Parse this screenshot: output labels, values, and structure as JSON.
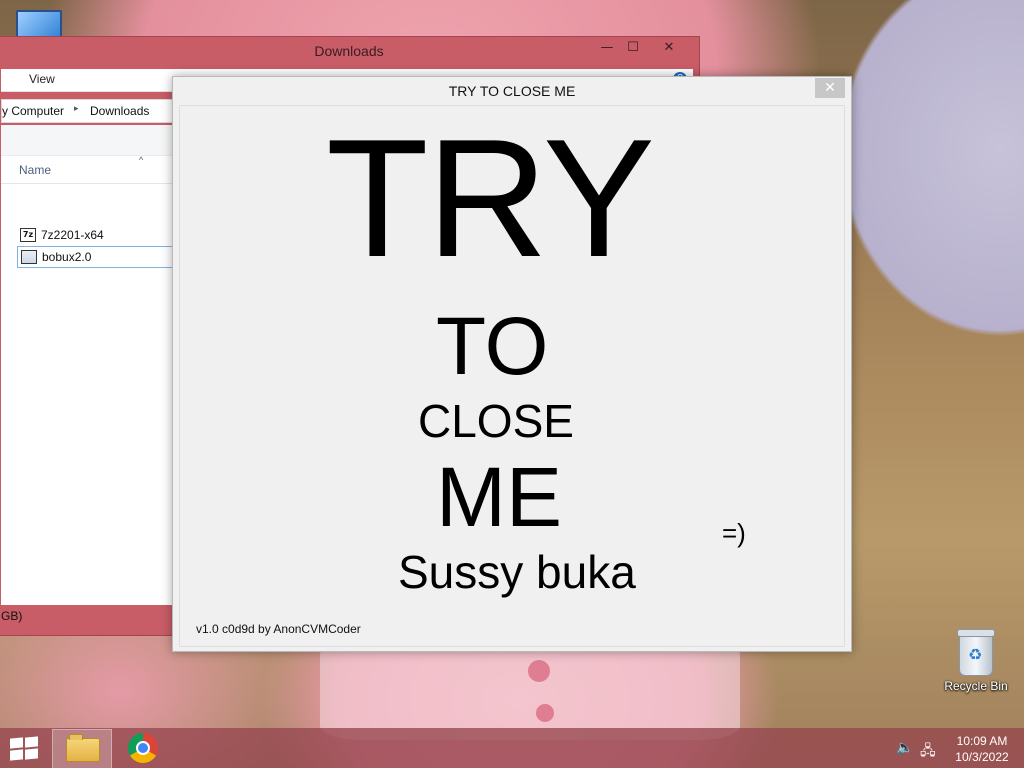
{
  "desktop": {
    "recycle_bin_label": "Recycle Bin",
    "computer_icon": "computer-icon"
  },
  "explorer": {
    "title": "Downloads",
    "controls": {
      "minimize": "—",
      "maximize": "☐",
      "close": "✕"
    },
    "menu": {
      "view": "View",
      "help": "?"
    },
    "address": {
      "crumb1": "y Computer",
      "separator": "▸",
      "crumb2": "Downloads"
    },
    "column_name": "Name",
    "sort_indicator": "^",
    "files": [
      {
        "name": "7z2201-x64",
        "icon": "7z"
      },
      {
        "name": "bobux2.0",
        "icon": ""
      }
    ],
    "status_text": "GB)"
  },
  "dialog": {
    "title": "TRY TO CLOSE ME",
    "close_glyph": "✕",
    "word_try": "TRY",
    "word_to": "TO",
    "word_close": "CLOSE",
    "word_me": "ME",
    "smiley": "=)",
    "subtitle": "Sussy buka",
    "version": "v1.0 c0d9d by AnonCVMCoder"
  },
  "taskbar": {
    "time": "10:09 AM",
    "date": "10/3/2022",
    "volume_icon": "🔈",
    "network_icon": "🖧"
  },
  "colors": {
    "explorer_frame": "#c85c67",
    "dialog_bg": "#f0f0f0",
    "taskbar": "#96464f"
  }
}
